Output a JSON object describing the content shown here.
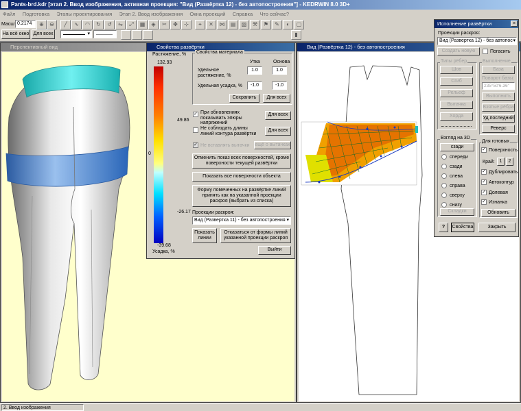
{
  "window": {
    "title": "Pants-brd.kdr [этап 2. Ввод изображения, активная проекция: \"Вид (Развёртка 12) - без автопостроения\"] - KEDRWIN 8.0 3D+"
  },
  "menu": [
    "Файл",
    "Подготовка",
    "Этапы проектирования",
    "Этап 2. Ввод изображения",
    "Окна проекций",
    "Справка",
    "Что сейчас?"
  ],
  "toolbar": {
    "scale_label": "Масшт",
    "scale_value": "0.2174",
    "whole_window": "На всё окно",
    "for_all": "Для всех"
  },
  "left_window": {
    "title": "Перспективный вид"
  },
  "right_window": {
    "title": "Вид (Развёртка 12) - без автопостроения"
  },
  "props_dialog": {
    "title": "Свойства развёртки",
    "scale_top": "Растяжение, %",
    "scale_bottom": "Усадка, %",
    "scale_values": [
      "132.93",
      "49.86",
      "0",
      "-26.17",
      "-39.68"
    ],
    "material_group": "Свойства материала",
    "col_weft": "Утка",
    "col_warp": "Основа",
    "stretch_label": "Удельное растяжение, %",
    "stretch_weft": "1.0",
    "stretch_warp": "1.0",
    "shrink_label": "Удельная усадка, %",
    "shrink_weft": "-1.0",
    "shrink_warp": "-1.0",
    "save": "Сохранить",
    "for_all": "Для всех",
    "chk1": "При обновлениях показывать эпюры напряжений",
    "chk2": "Не соблюдать длины линий контура развёртки",
    "chk3": "Не вставлять вытачки",
    "for_all2": "Для всех",
    "for_all3": "Для всех",
    "darts_btn": "ещё о вытачках",
    "cancel_show": "Отменить показ всех поверхностей, кроме поверхности текущей развёртки",
    "show_all": "Показать все поверхности объекта",
    "form_btn": "Форму помеченных на развёртке линий принять как на указанной проекции раскроя (выбрать из списка)",
    "proj_label": "Проекции раскроя:",
    "proj_value": "Вид (Развертка 11) - без автопостроения",
    "show_lines": "Показать линии",
    "reject_form": "Отказаться от формы линий указанной проекции раскроя",
    "exit": "Выйти"
  },
  "exec_panel": {
    "title": "Исполнение развёртки",
    "proj_label": "Проекции раскроя:",
    "proj_value": "Вид (Развертка 12) - без автопос",
    "create_new": "Создать новую",
    "extinguish": "Погасить",
    "rib_types": "Типы рёбер",
    "execution": "Выполнение",
    "seam": "Шов",
    "fold": "Сгиб",
    "relief": "Рельеф",
    "dart": "Вытачка",
    "chord": "Хорда",
    "base": "База",
    "rotate_label": "Поворот базы:",
    "rotate_value": "235°50'6.36\"",
    "execute": "Выполнить",
    "taken_ribs": "Взятые рёбра",
    "del_last": "Уд.последний",
    "reverse": "Реверс",
    "view3d": "Взгляд на 3D",
    "views": [
      "сзади",
      "спереди",
      "сзади",
      "слева",
      "справа",
      "сверху",
      "снизу"
    ],
    "folds": "Складки",
    "for_ready": "Для готовых",
    "surface": "Поверхность",
    "edge_label": "Край:",
    "edge1": "1",
    "edge2": "2",
    "dup": "Дублировать",
    "autocontour": "Автоконтур",
    "grain": "Долевая",
    "inside": "Изнанка",
    "update": "Обновить",
    "help": "?",
    "properties": "Свойства",
    "close": "Закрыть"
  },
  "status": {
    "text": "2. Ввод изображения"
  }
}
